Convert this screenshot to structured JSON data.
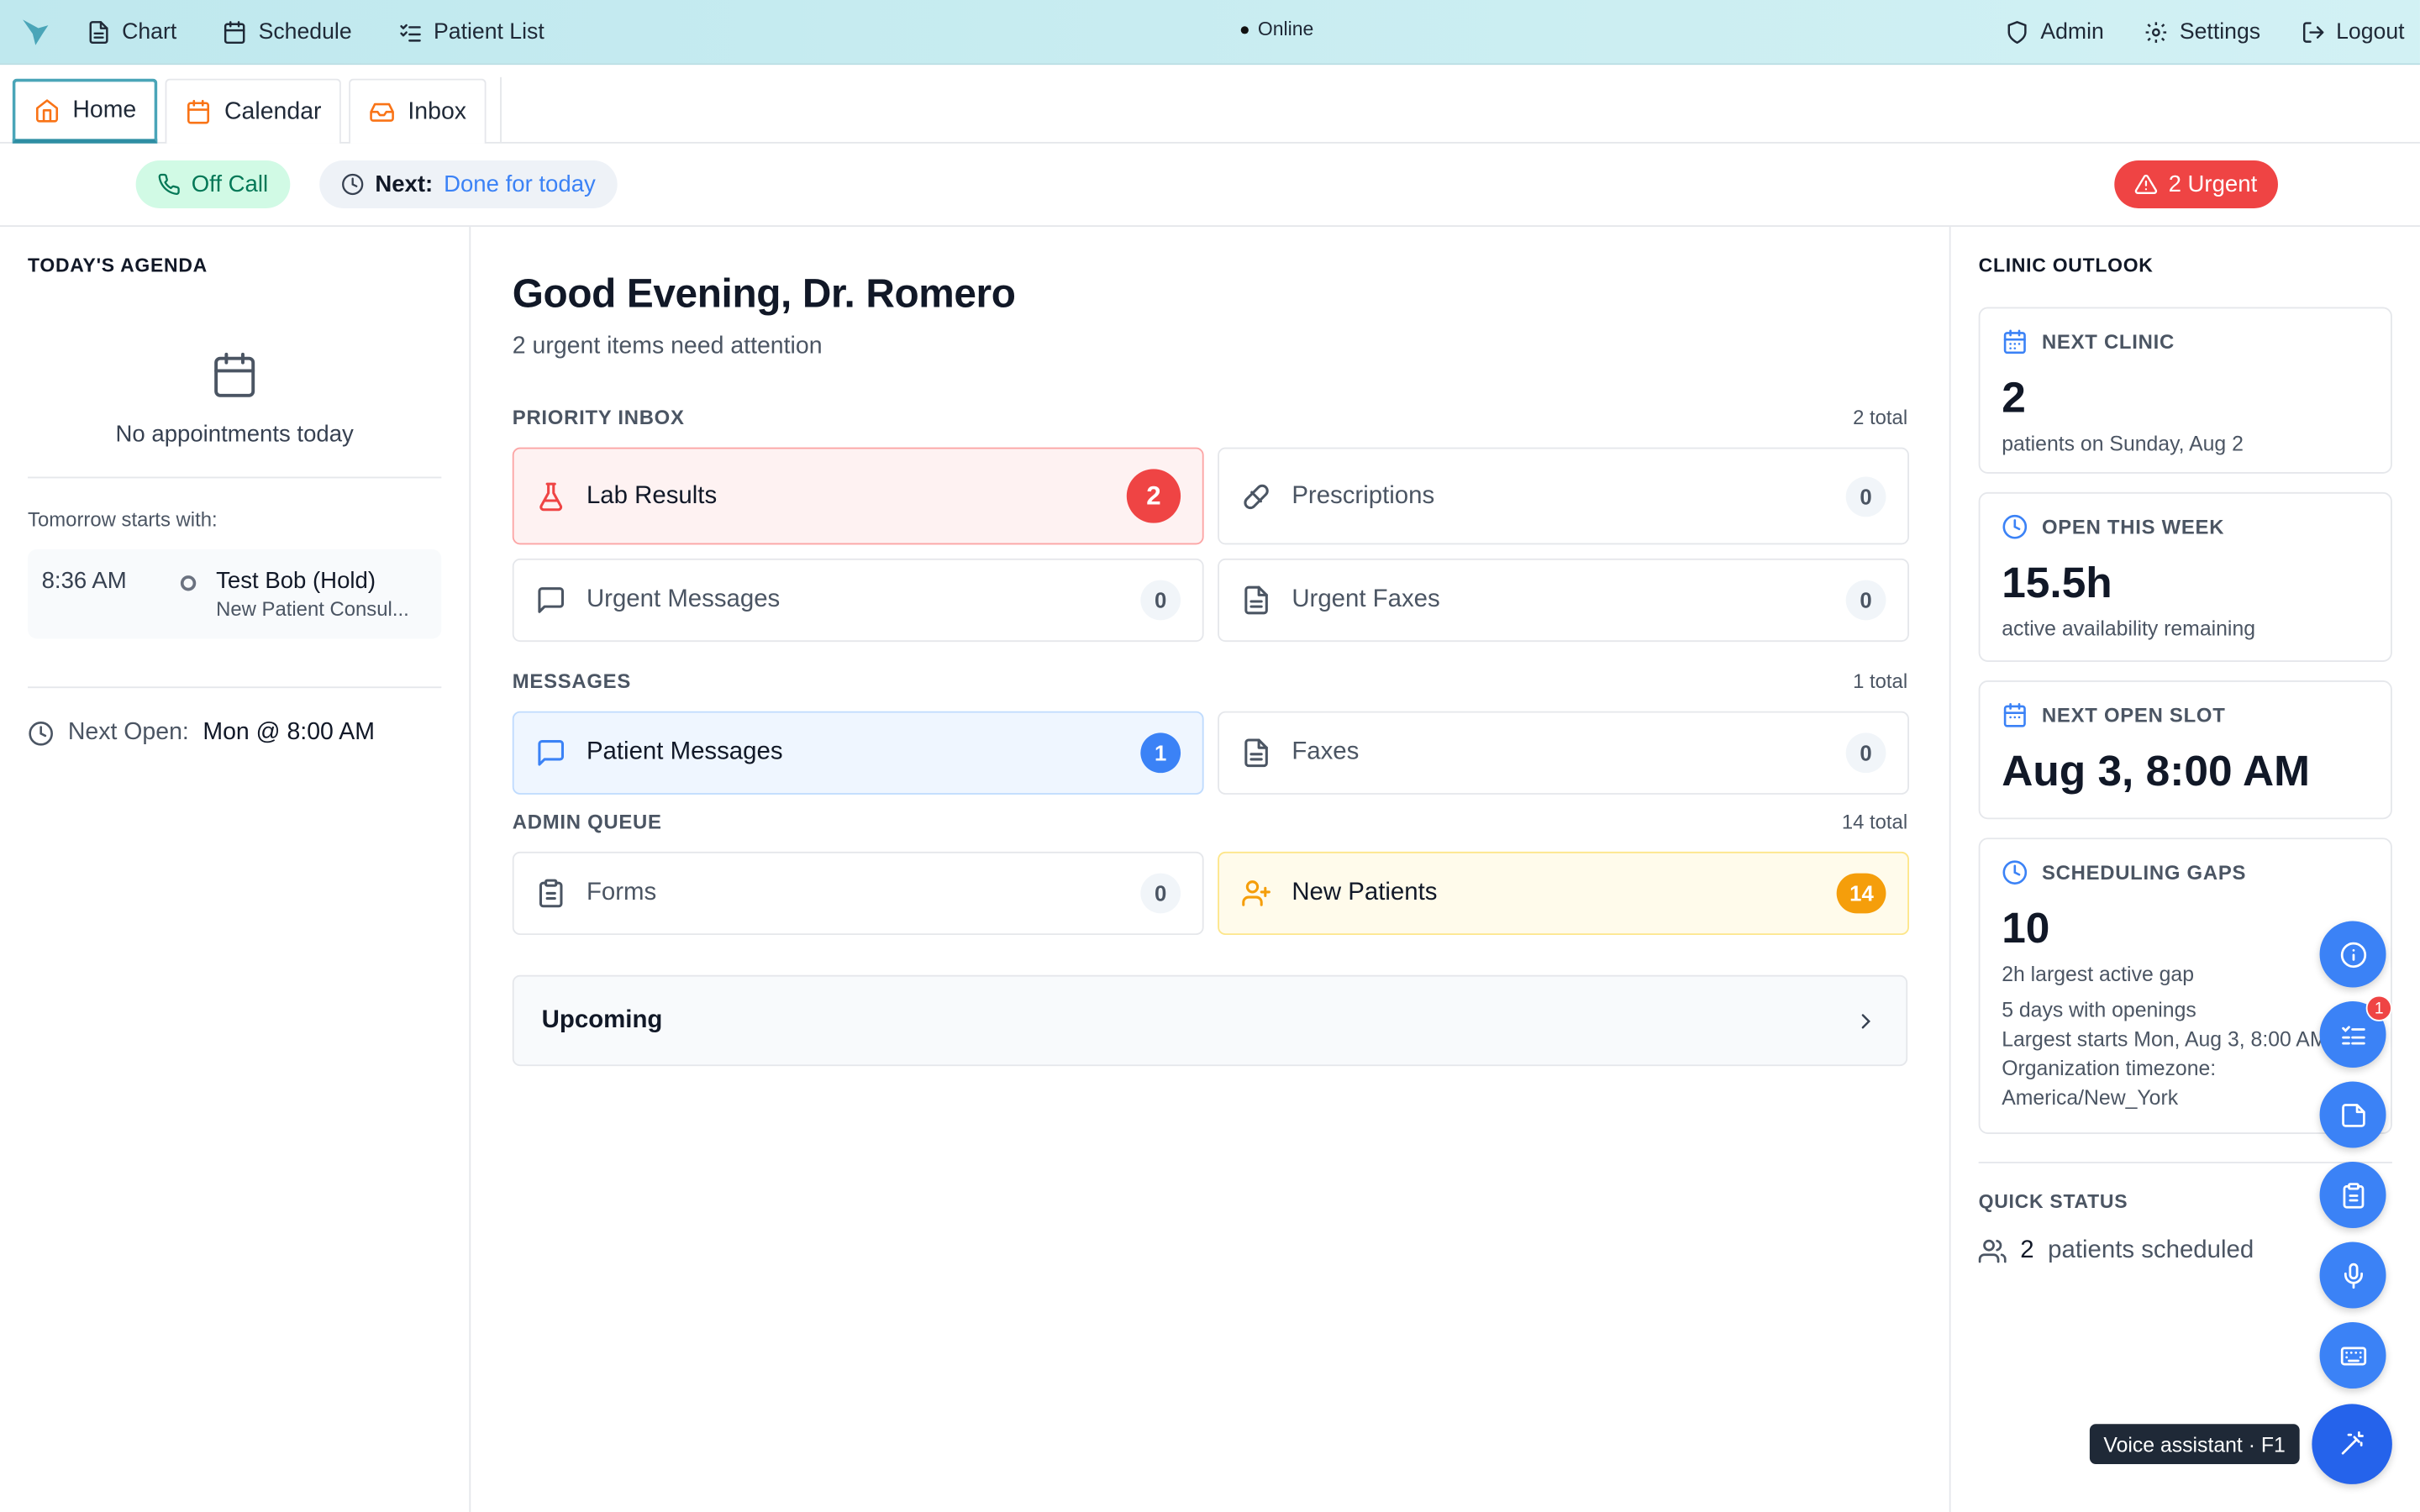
{
  "topbar": {
    "nav": [
      {
        "label": "Chart",
        "icon": "file-text-icon"
      },
      {
        "label": "Schedule",
        "icon": "calendar-icon"
      },
      {
        "label": "Patient List",
        "icon": "list-checks-icon"
      }
    ],
    "status": "Online",
    "right": [
      {
        "label": "Admin",
        "icon": "shield-icon"
      },
      {
        "label": "Settings",
        "icon": "gear-icon"
      },
      {
        "label": "Logout",
        "icon": "logout-icon"
      }
    ]
  },
  "tabs": [
    {
      "label": "Home",
      "icon": "home-icon",
      "active": true
    },
    {
      "label": "Calendar",
      "icon": "calendar-icon"
    },
    {
      "label": "Inbox",
      "icon": "inbox-icon"
    }
  ],
  "strip": {
    "call_status": "Off Call",
    "next_label": "Next:",
    "next_value": "Done for today",
    "urgent": "2 Urgent"
  },
  "agenda": {
    "title": "TODAY'S AGENDA",
    "empty": "No appointments today",
    "tomorrow_label": "Tomorrow starts with:",
    "appointment": {
      "time": "8:36 AM",
      "name": "Test Bob (Hold)",
      "type": "New Patient Consul..."
    },
    "next_open_label": "Next Open:",
    "next_open_value": "Mon @ 8:00 AM"
  },
  "greeting": {
    "title": "Good Evening, Dr. Romero",
    "subtitle": "2 urgent items need attention"
  },
  "groups": {
    "priority": {
      "label": "PRIORITY INBOX",
      "total": "2 total",
      "items": [
        {
          "label": "Lab Results",
          "count": "2"
        },
        {
          "label": "Prescriptions",
          "count": "0"
        },
        {
          "label": "Urgent Messages",
          "count": "0"
        },
        {
          "label": "Urgent Faxes",
          "count": "0"
        }
      ]
    },
    "messages": {
      "label": "MESSAGES",
      "total": "1 total",
      "items": [
        {
          "label": "Patient Messages",
          "count": "1"
        },
        {
          "label": "Faxes",
          "count": "0"
        }
      ]
    },
    "admin": {
      "label": "ADMIN QUEUE",
      "total": "14 total",
      "items": [
        {
          "label": "Forms",
          "count": "0"
        },
        {
          "label": "New Patients",
          "count": "14"
        }
      ]
    }
  },
  "upcoming": {
    "label": "Upcoming"
  },
  "outlook": {
    "title": "CLINIC OUTLOOK",
    "cards": [
      {
        "head": "NEXT CLINIC",
        "big": "2",
        "desc": "patients on Sunday, Aug 2"
      },
      {
        "head": "OPEN THIS WEEK",
        "big": "15.5h",
        "desc": "active availability remaining"
      },
      {
        "head": "NEXT OPEN SLOT",
        "big": "Aug 3, 8:00 AM"
      },
      {
        "head": "SCHEDULING GAPS",
        "big": "10",
        "desc": "2h largest active gap",
        "lines": [
          "5 days with openings",
          "Largest starts Mon, Aug 3, 8:00 AM",
          "Organization timezone:",
          "America/New_York"
        ]
      }
    ],
    "quick_status_title": "QUICK STATUS",
    "quick_status_count": "2",
    "quick_status_text": "patients scheduled"
  },
  "fab": {
    "notif_count": "1",
    "tooltip": "Voice assistant · F1"
  },
  "colors": {
    "accent": "#3b82f6",
    "urgent": "#ef4444",
    "teal": "#2e8ea3",
    "amber": "#f59e0b",
    "green": "#047857"
  }
}
